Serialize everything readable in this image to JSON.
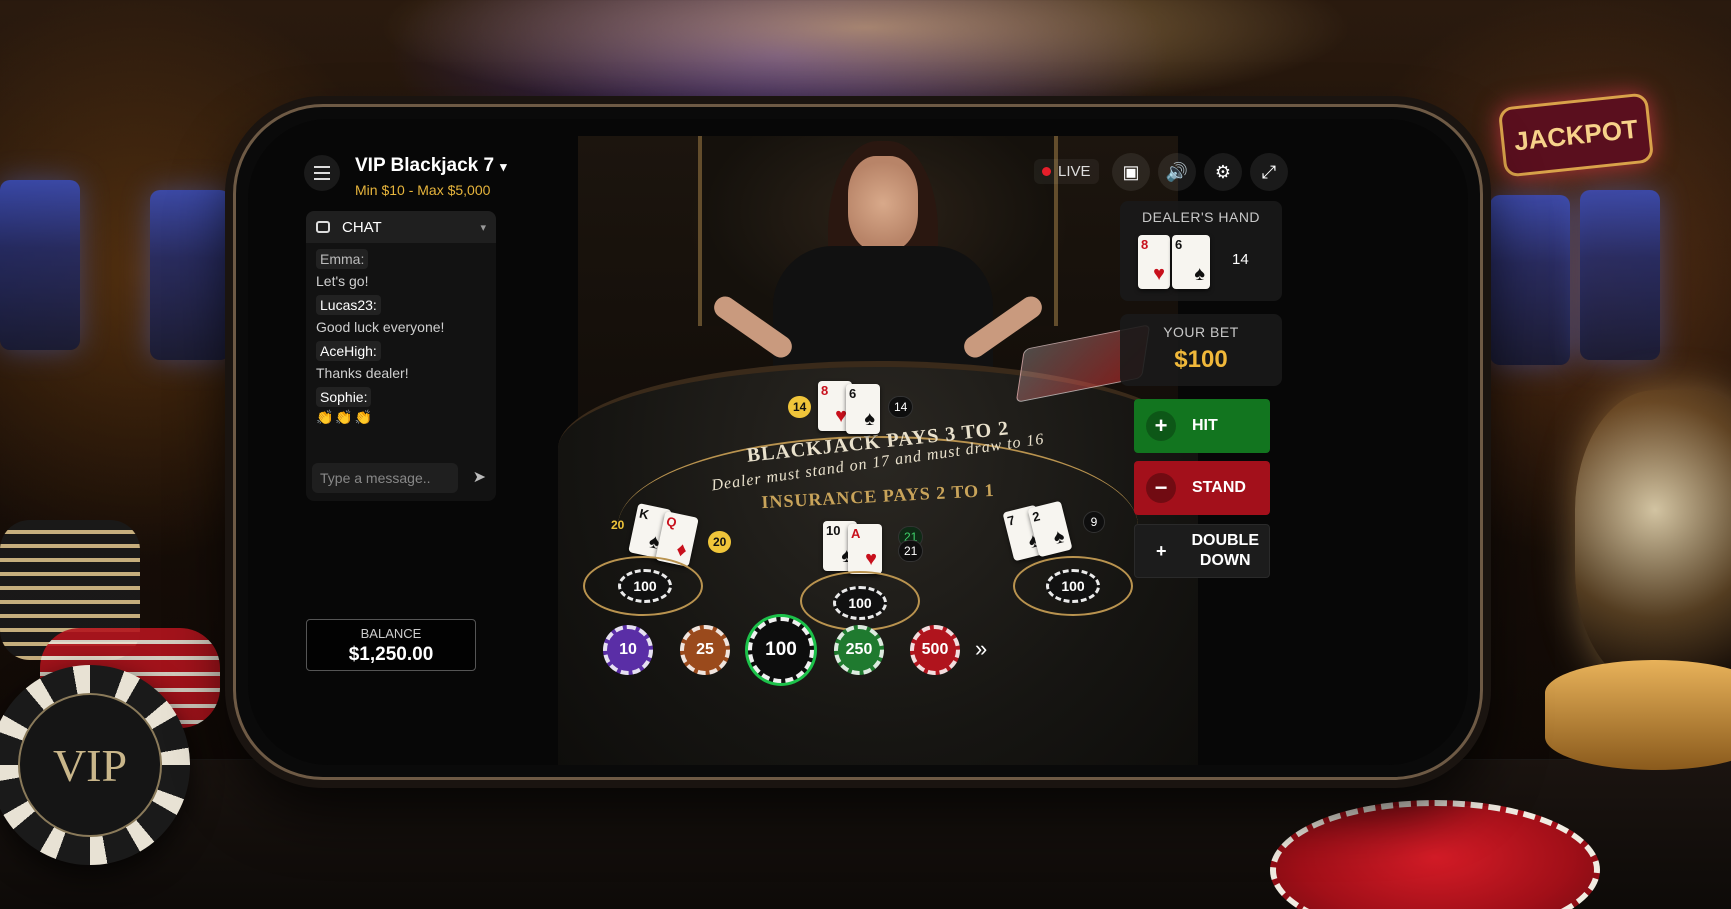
{
  "header": {
    "table_name": "VIP Blackjack 7",
    "limits": "Min $10 - Max $5,000"
  },
  "icons": {
    "menu": "menu-icon",
    "chevron": "chevron-down-icon",
    "chat": "chat-icon",
    "send": "send-icon",
    "video": "video-icon",
    "sound": "sound-icon",
    "settings": "gear-icon",
    "fullscreen": "fullscreen-icon"
  },
  "chat": {
    "title": "CHAT",
    "messages": [
      {
        "user": "Emma:",
        "text": "Let's go!"
      },
      {
        "user": "Lucas23:",
        "text": "Good luck everyone!"
      },
      {
        "user": "AceHigh:",
        "text": "Thanks dealer!"
      },
      {
        "user": "Sophie:",
        "text": "👏👏👏"
      }
    ],
    "placeholder": "Type a message.."
  },
  "status": {
    "live_label": "LIVE"
  },
  "table": {
    "main_text": "BLACKJACK PAYS 3 TO 2",
    "rule_text": "Dealer must stand on 17 and must draw to 16",
    "insurance_text": "INSURANCE PAYS 2 TO 1",
    "dealer_cards": [
      {
        "rank": "8",
        "suit": "♥",
        "color": "red"
      },
      {
        "rank": "6",
        "suit": "♠",
        "color": "black"
      }
    ],
    "dealer_total": "14",
    "dealer_badge": "14",
    "seats": [
      {
        "cards": [
          {
            "rank": "K",
            "suit": "♠",
            "color": "black"
          },
          {
            "rank": "Q",
            "suit": "♦",
            "color": "red"
          }
        ],
        "total": "20",
        "left_total": "20",
        "bet": "100"
      },
      {
        "cards": [
          {
            "rank": "10",
            "suit": "♠",
            "color": "black"
          },
          {
            "rank": "A",
            "suit": "♥",
            "color": "red"
          }
        ],
        "total": "21",
        "left_total": "21",
        "bet": "100"
      },
      {
        "cards": [
          {
            "rank": "7",
            "suit": "♠",
            "color": "black"
          },
          {
            "rank": "2",
            "suit": "♠",
            "color": "black"
          }
        ],
        "total": "9",
        "bet": "100"
      }
    ]
  },
  "dealer_panel": {
    "label": "DEALER'S HAND",
    "cards": [
      {
        "rank": "8",
        "suit": "♥"
      },
      {
        "rank": "6",
        "suit": "♠"
      }
    ],
    "total": "14"
  },
  "bet_panel": {
    "label": "YOUR BET",
    "value": "$100"
  },
  "actions": {
    "hit": "HIT",
    "stand": "STAND",
    "double_line1": "DOUBLE",
    "double_line2": "DOWN"
  },
  "balance": {
    "label": "BALANCE",
    "value": "$1,250.00"
  },
  "chips": [
    {
      "value": "10",
      "color": "#5a2ea6"
    },
    {
      "value": "25",
      "color": "#9a4a1c"
    },
    {
      "value": "100",
      "color": "#0d0d0d",
      "selected": true
    },
    {
      "value": "250",
      "color": "#1f7a2f"
    },
    {
      "value": "500",
      "color": "#b0141d"
    }
  ],
  "more_label": "»",
  "background": {
    "jackpot_sign": "JACKPOT",
    "vip_chip": "VIP"
  }
}
